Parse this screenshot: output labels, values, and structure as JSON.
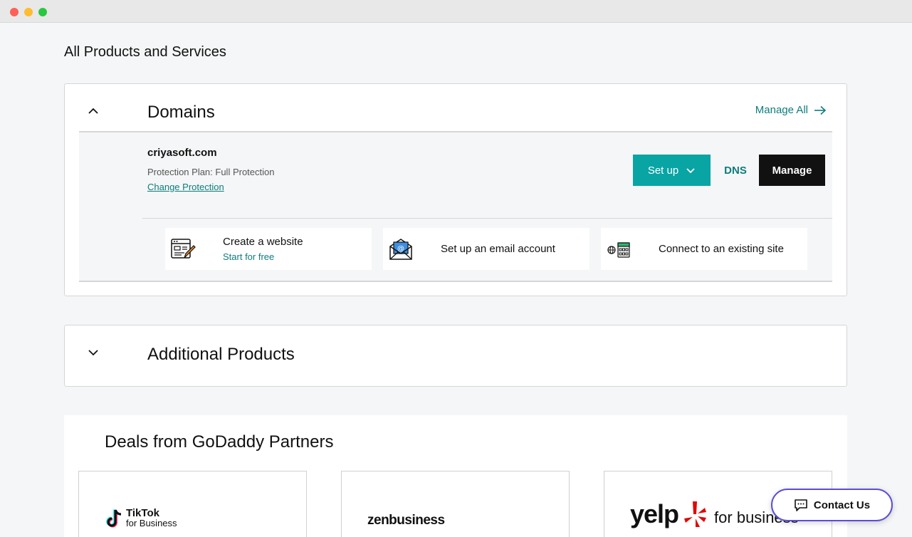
{
  "page": {
    "title": "All Products and Services"
  },
  "domains": {
    "heading": "Domains",
    "manage_all": "Manage All",
    "domain": {
      "name": "criyasoft.com",
      "protection": "Protection Plan: Full Protection",
      "change_protection": "Change Protection"
    },
    "buttons": {
      "setup": "Set up",
      "dns": "DNS",
      "manage": "Manage"
    },
    "actions": [
      {
        "title": "Create a website",
        "subtitle": "Start for free",
        "icon": "website-builder-icon"
      },
      {
        "title": "Set up an email account",
        "subtitle": "",
        "icon": "email-envelope-icon"
      },
      {
        "title": "Connect to an existing site",
        "subtitle": "",
        "icon": "globe-server-icon"
      }
    ]
  },
  "additional": {
    "heading": "Additional Products"
  },
  "deals": {
    "title": "Deals from GoDaddy Partners",
    "partners": [
      {
        "name": "TikTok",
        "tagline": "for Business"
      },
      {
        "name": "zenbusiness",
        "tagline": ""
      },
      {
        "name": "yelp",
        "tagline": "for business"
      }
    ]
  },
  "contact": {
    "label": "Contact Us"
  },
  "colors": {
    "accent": "#09a4a4",
    "link": "#0f7c7c",
    "dark": "#111111",
    "contact_border": "#5b4fd6"
  }
}
